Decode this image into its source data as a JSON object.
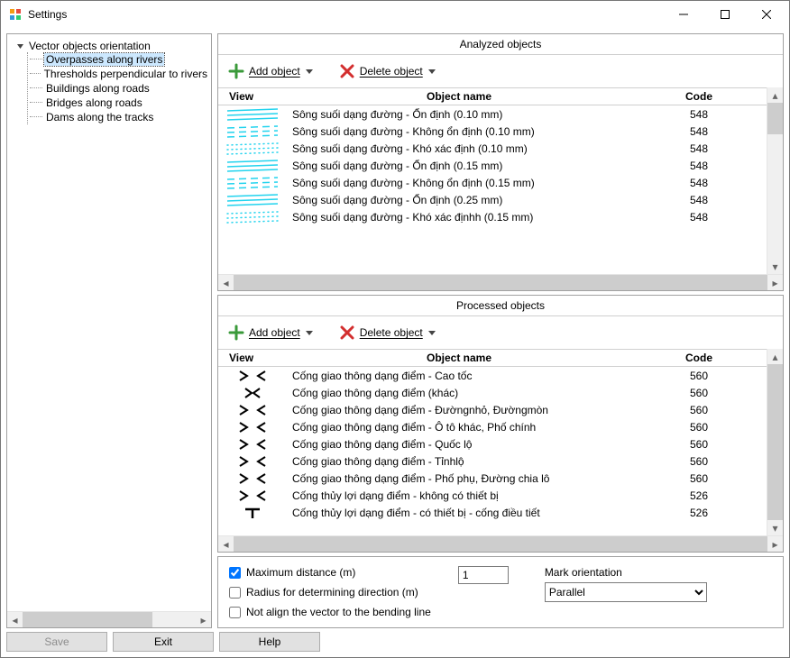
{
  "window": {
    "title": "Settings"
  },
  "titlebar_controls": {
    "minimize": "minimize",
    "maximize": "maximize",
    "close": "close"
  },
  "tree": {
    "root_label": "Vector objects orientation",
    "items": [
      {
        "label": "Overpasses along rivers",
        "selected": true
      },
      {
        "label": "Thresholds perpendicular to rivers",
        "selected": false
      },
      {
        "label": "Buildings along roads",
        "selected": false
      },
      {
        "label": "Bridges along roads",
        "selected": false
      },
      {
        "label": "Dams along the tracks",
        "selected": false
      }
    ]
  },
  "analyzed": {
    "title": "Analyzed objects",
    "add_label": "Add object",
    "delete_label": "Delete object",
    "columns": {
      "view": "View",
      "name": "Object name",
      "code": "Code"
    },
    "rows": [
      {
        "style": "river-solid",
        "name": "Sông suối dạng đường - Ổn định (0.10 mm)",
        "code": "548"
      },
      {
        "style": "river-dashed",
        "name": "Sông suối dạng đường - Không ổn định (0.10 mm)",
        "code": "548"
      },
      {
        "style": "river-dotted",
        "name": "Sông suối dạng đường - Khó xác định (0.10 mm)",
        "code": "548"
      },
      {
        "style": "river-solid",
        "name": "Sông suối dạng đường - Ổn định (0.15 mm)",
        "code": "548"
      },
      {
        "style": "river-dashed",
        "name": "Sông suối dạng đường - Không ổn định (0.15 mm)",
        "code": "548"
      },
      {
        "style": "river-solid",
        "name": "Sông suối dạng đường - Ổn định (0.25 mm)",
        "code": "548"
      },
      {
        "style": "river-dotted",
        "name": "Sông suối dạng đường - Khó xác địnhh (0.15 mm)",
        "code": "548"
      }
    ]
  },
  "processed": {
    "title": "Processed objects",
    "add_label": "Add object",
    "delete_label": "Delete object",
    "columns": {
      "view": "View",
      "name": "Object name",
      "code": "Code"
    },
    "rows": [
      {
        "style": "arrows-wide",
        "name": "Cống giao thông dạng điểm - Cao tốc",
        "code": "560"
      },
      {
        "style": "arrows-narrow",
        "name": "Cống giao thông dạng điểm (khác)",
        "code": "560"
      },
      {
        "style": "arrows-wide",
        "name": "Cống giao thông dạng điểm - Đườngnhỏ, Đườngmòn",
        "code": "560"
      },
      {
        "style": "arrows-wide",
        "name": "Cống giao thông dạng điểm - Ô tô khác, Phố chính",
        "code": "560"
      },
      {
        "style": "arrows-wide",
        "name": "Cống giao thông dạng điểm - Quốc lộ",
        "code": "560"
      },
      {
        "style": "arrows-wide",
        "name": "Cống giao thông dạng điểm - Tỉnhlộ",
        "code": "560"
      },
      {
        "style": "arrows-wide",
        "name": "Cống giao thông dạng điểm - Phố phụ, Đường chia lô",
        "code": "560"
      },
      {
        "style": "arrows-wide",
        "name": "Cống thủy lợi dạng điểm - không có thiết bị",
        "code": "526"
      },
      {
        "style": "culvert-t",
        "name": "Cống thủy lợi dạng điểm - có thiết bị - cống điều tiết",
        "code": "526"
      }
    ]
  },
  "options": {
    "max_distance_label": "Maximum distance (m)",
    "max_distance_checked": true,
    "max_distance_value": "1",
    "radius_label": "Radius for determining direction (m)",
    "radius_checked": false,
    "not_align_label": "Not align the vector to the bending line",
    "not_align_checked": false,
    "mark_orientation_label": "Mark orientation",
    "mark_orientation_value": "Parallel",
    "mark_orientation_options": [
      "Parallel"
    ]
  },
  "footer": {
    "save": "Save",
    "exit": "Exit",
    "help": "Help",
    "save_enabled": false
  }
}
